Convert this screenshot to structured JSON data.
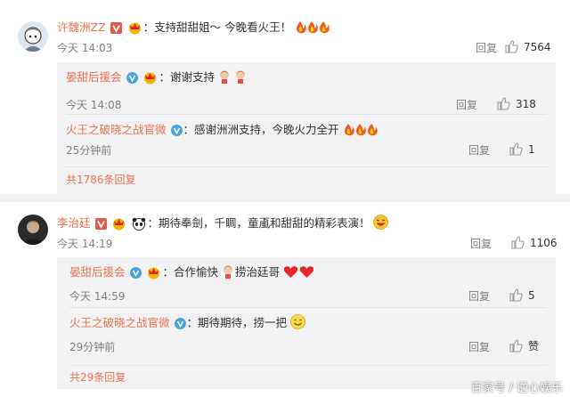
{
  "comments": [
    {
      "user": "许魏洲ZZ",
      "colon": "：",
      "text": "支持甜甜姐～ 今晚看火王！",
      "time": "今天 14:03",
      "reply": "回复",
      "likes": "7564",
      "replies": [
        {
          "user": "晏甜后援会",
          "colon": "：",
          "text": "谢谢支持",
          "time": "今天 14:08",
          "reply": "回复",
          "likes": "318"
        },
        {
          "user": "火王之破晓之战官微",
          "colon": "：",
          "text": "感谢洲洲支持，今晚火力全开",
          "time": "25分钟前",
          "reply": "回复",
          "likes": "1"
        }
      ],
      "more": "共1786条回复"
    },
    {
      "user": "李治廷",
      "colon": "：",
      "text": "期待奉劍，千睭，童颪和甜甜的精彩表演！",
      "time": "今天 14:19",
      "reply": "回复",
      "likes": "1106",
      "replies": [
        {
          "user": "晏甜后援会",
          "colon": "：",
          "text": "合作愉快",
          "text2": "捞治廷哥",
          "time": "今天 14:59",
          "reply": "回复",
          "likes": "5"
        },
        {
          "user": "火王之破晓之战官微",
          "colon": "：",
          "text": "期待期待，捞一把",
          "time": "29分钟前",
          "reply": "回复",
          "likes": "赞"
        }
      ],
      "more": "共29条回复"
    }
  ],
  "watermark": "百家号 / 逆心娱乐",
  "colors": {
    "username": "#eb7350",
    "muted": "#808080",
    "subbox": "#f2f2f5",
    "verified": "#4aa3df",
    "vip": "#f08a00"
  },
  "icons": [
    "avatar-anime",
    "avatar-man",
    "verified-v",
    "vip-crown",
    "thumb-up-icon",
    "fire-emoji",
    "heart-emoji",
    "grin-emoji",
    "panda-emoji",
    "smile-emoji",
    "doll-emoji"
  ]
}
